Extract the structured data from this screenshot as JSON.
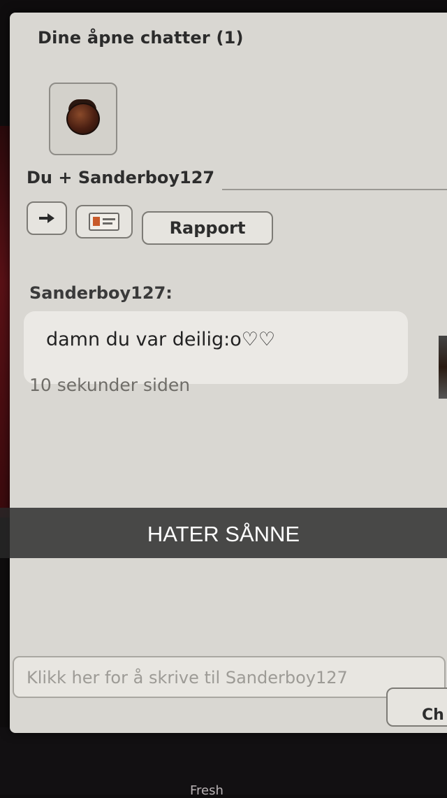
{
  "chat_window": {
    "header": "Dine åpne chatter (1)",
    "title": "Du + Sanderboy127",
    "report_label": "Rapport"
  },
  "message": {
    "sender": "Sanderboy127:",
    "text": "damn du var deilig:o♡♡",
    "timestamp": "10 sekunder siden"
  },
  "caption": {
    "text": "HATER SÅNNE"
  },
  "composer": {
    "placeholder": "Klikk her for å skrive til Sanderboy127",
    "send_label_partial": "Ch"
  },
  "background": {
    "partial_text": "Fresh"
  },
  "icons": [
    "arrow-right-icon",
    "id-card-icon",
    "avatar-icon"
  ],
  "colors": {
    "window_bg": "#d9d7d2",
    "caption_bar": "#282828",
    "text_dark": "#2b2b2b"
  }
}
